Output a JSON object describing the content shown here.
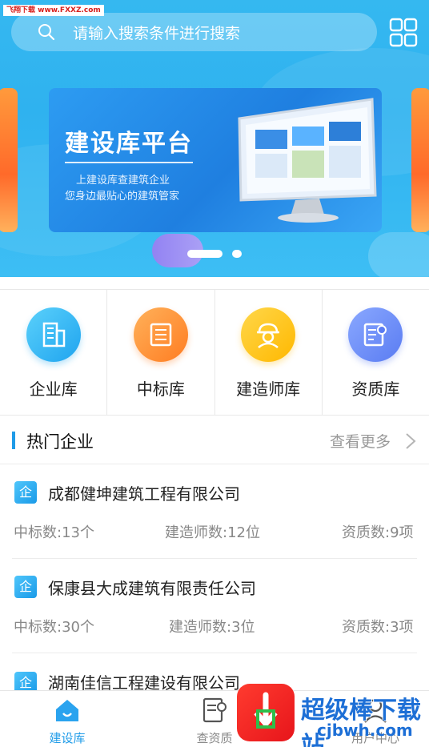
{
  "watermark_top": "飞翔下载 www.FXXZ.com",
  "search": {
    "placeholder": "请输入搜索条件进行搜索"
  },
  "banner": {
    "title": "建设库平台",
    "subtitle_1": "上建设库查建筑企业",
    "subtitle_2": "您身边最贴心的建筑管家",
    "active_slide_index": 0,
    "slide_count": 2
  },
  "categories": [
    {
      "label": "企业库",
      "icon": "building-icon",
      "color": "#2aaef2"
    },
    {
      "label": "中标库",
      "icon": "document-list-icon",
      "color": "#ff8a2a"
    },
    {
      "label": "建造师库",
      "icon": "engineer-helmet-icon",
      "color": "#ffc21a"
    },
    {
      "label": "资质库",
      "icon": "certificate-icon",
      "color": "#6d8cf5"
    }
  ],
  "hot_section": {
    "title": "热门企业",
    "more": "查看更多"
  },
  "companies": [
    {
      "badge": "企",
      "name": "成都健坤建筑工程有限公司",
      "bids": "中标数:13个",
      "builders": "建造师数:12位",
      "quals": "资质数:9项"
    },
    {
      "badge": "企",
      "name": "保康县大成建筑有限责任公司",
      "bids": "中标数:30个",
      "builders": "建造师数:3位",
      "quals": "资质数:3项"
    },
    {
      "badge": "企",
      "name": "湖南佳信工程建设有限公司",
      "bids": "",
      "builders": "",
      "quals": ""
    }
  ],
  "bottom_nav": [
    {
      "label": "建设库",
      "icon": "home-icon",
      "active": true
    },
    {
      "label": "查资质",
      "icon": "certificate-icon",
      "active": false
    },
    {
      "label": "",
      "icon": "",
      "active": false
    },
    {
      "label": "用户中心",
      "icon": "user-icon",
      "active": false
    }
  ],
  "watermark_brand": {
    "line1": "超级棒下载站",
    "line2": "cjbwh.com"
  },
  "colors": {
    "accent": "#1e9be8",
    "hero": "#35b8f0"
  }
}
